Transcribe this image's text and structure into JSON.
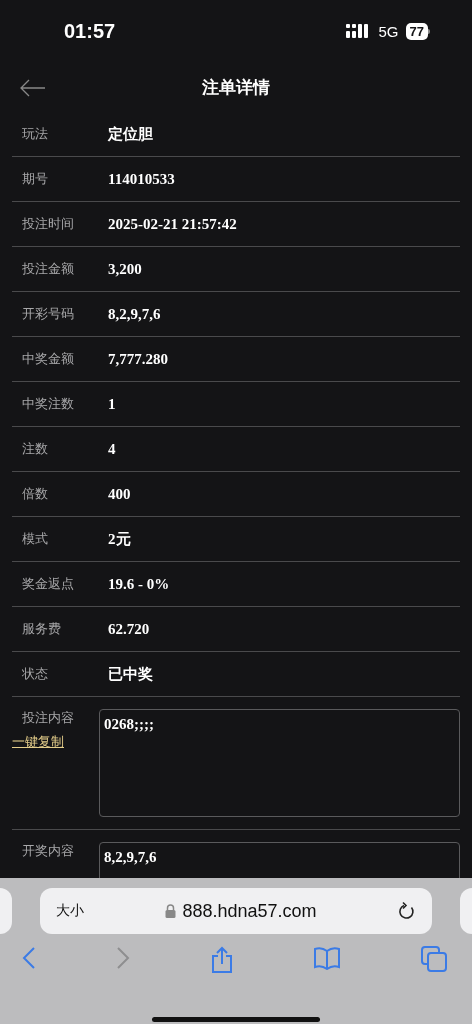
{
  "status_bar": {
    "time": "01:57",
    "network": "5G",
    "battery": "77"
  },
  "header": {
    "title": "注单详情"
  },
  "rows": [
    {
      "label": "玩法",
      "value": "定位胆"
    },
    {
      "label": "期号",
      "value": "114010533"
    },
    {
      "label": "投注时间",
      "value": "2025-02-21 21:57:42"
    },
    {
      "label": "投注金额",
      "value": "3,200"
    },
    {
      "label": "开彩号码",
      "value": "8,2,9,7,6"
    },
    {
      "label": "中奖金额",
      "value": "7,777.280"
    },
    {
      "label": "中奖注数",
      "value": "1"
    },
    {
      "label": "注数",
      "value": "4"
    },
    {
      "label": "倍数",
      "value": "400"
    },
    {
      "label": "模式",
      "value": "2元"
    },
    {
      "label": "奖金返点",
      "value": "19.6 - 0%"
    },
    {
      "label": "服务费",
      "value": "62.720"
    },
    {
      "label": "状态",
      "value": "已中奖"
    }
  ],
  "content_rows": [
    {
      "label": "投注内容",
      "link": "一键复制",
      "value": "0268;;;;"
    },
    {
      "label": "开奖内容",
      "value": "8,2,9,7,6"
    }
  ],
  "browser": {
    "text_size": "大小",
    "url": "888.hdna57.com",
    "forward_disabled": true
  }
}
